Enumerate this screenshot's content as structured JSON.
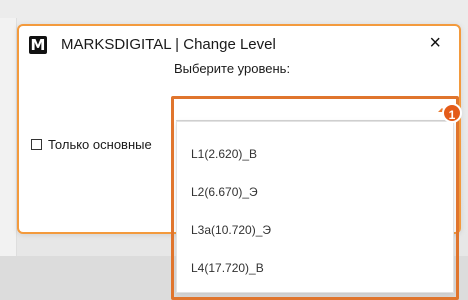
{
  "dialog": {
    "logo": "M",
    "title": "MARKSDIGITAL | Change Level",
    "close_symbol": "×",
    "prompt": "Выберите уровень:"
  },
  "checkbox": {
    "label": "Только основные"
  },
  "dropdown": {
    "items": [
      "L1(2.620)_B",
      "L2(6.670)_Э",
      "L3a(10.720)_Э",
      "L4(17.720)_B"
    ]
  },
  "annotation": {
    "badge_number": "1",
    "accent_color": "#e45b19"
  }
}
